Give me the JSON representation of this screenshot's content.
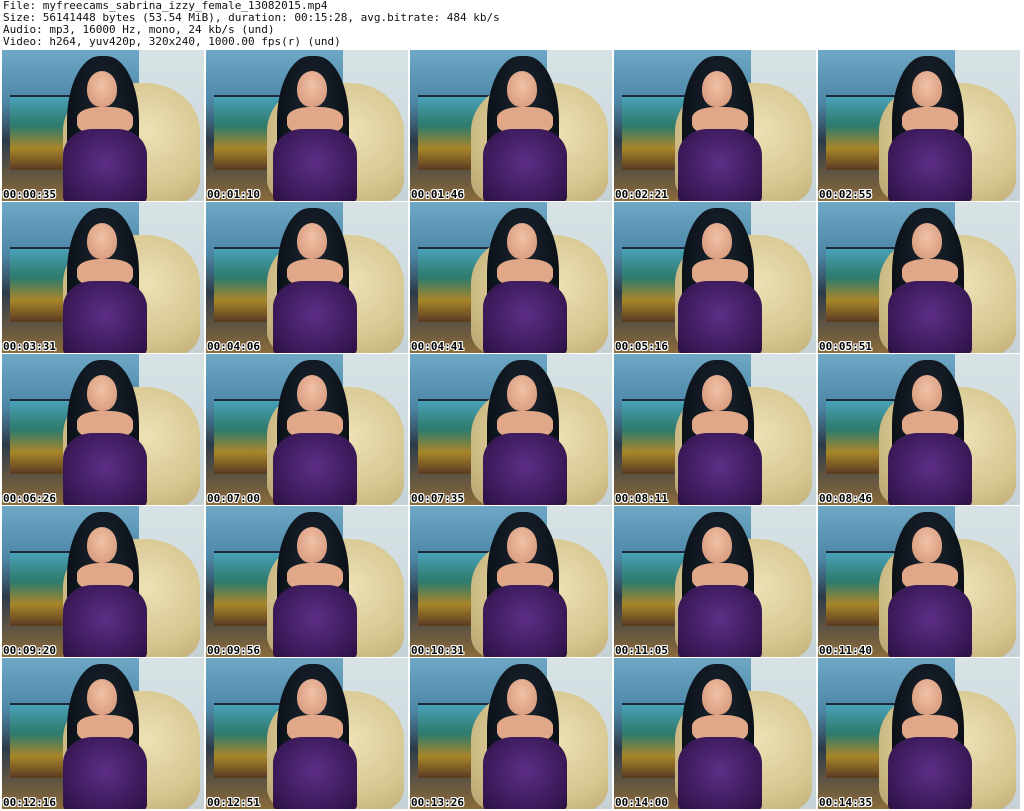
{
  "header": {
    "file_line": "File: myfreecams_sabrina_izzy_female_13082015.mp4",
    "size_line": "Size: 56141448 bytes (53.54 MiB), duration: 00:15:28, avg.bitrate: 484 kb/s",
    "audio_line": "Audio: mp3, 16000 Hz, mono, 24 kb/s (und)",
    "video_line": "Video: h264, yuv420p, 320x240, 1000.00 fps(r) (und)"
  },
  "thumbnails": [
    "00:00:35",
    "00:01:10",
    "00:01:46",
    "00:02:21",
    "00:02:55",
    "00:03:31",
    "00:04:06",
    "00:04:41",
    "00:05:16",
    "00:05:51",
    "00:06:26",
    "00:07:00",
    "00:07:35",
    "00:08:11",
    "00:08:46",
    "00:09:20",
    "00:09:56",
    "00:10:31",
    "00:11:05",
    "00:11:40",
    "00:12:16",
    "00:12:51",
    "00:13:26",
    "00:14:00",
    "00:14:35"
  ]
}
